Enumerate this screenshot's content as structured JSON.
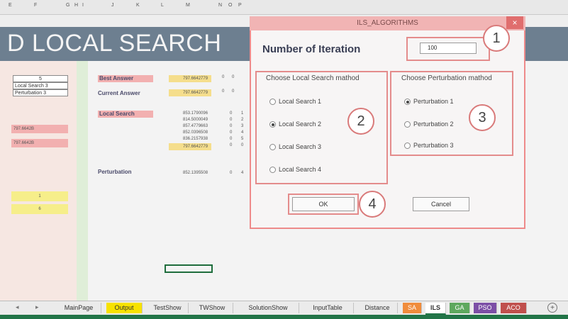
{
  "sheet": {
    "banner_title": "D LOCAL SEARCH",
    "columns": [
      "E",
      "F",
      "G",
      "H",
      "I",
      "J",
      "K",
      "L",
      "M",
      "N",
      "O",
      "P"
    ],
    "left_panel": {
      "cell_top": "5",
      "cell_a": "Local Search 3",
      "cell_b": "Perturbation 3",
      "pink_val_1": "797.6642B",
      "pink_val_2": "797.6642B",
      "yellow_val_1": "1",
      "yellow_val_2": "6"
    },
    "labels": {
      "best_answer": "Best Answer",
      "current_answer": "Current Answer",
      "local_search": "Local Search",
      "perturbation": "Perturbation"
    },
    "values": {
      "best": "797.6642779",
      "current": "797.6642779",
      "ls_rows": [
        "853.1790096",
        "814.5000049",
        "857.4779663",
        "852.0396508",
        "836.2157938",
        "797.6642779"
      ],
      "ls_counts": [
        "1",
        "2",
        "3",
        "4",
        "5",
        "0"
      ],
      "perturb": "852.1395508",
      "perturb_count": "4"
    }
  },
  "tabs": {
    "items": [
      "MainPage",
      "Output",
      "TestShow",
      "TWShow",
      "SolutionShow",
      "InputTable",
      "Distance",
      "SA",
      "ILS",
      "GA",
      "PSO",
      "ACO"
    ]
  },
  "colors": {
    "output_tab": "#f7e200",
    "sa_tab": "#f08c3c",
    "ils_tab": "#ffffff",
    "ga_tab": "#5ea85e",
    "pso_tab": "#7c4fa6",
    "aco_tab": "#c0504d",
    "dialog_border": "#ee8a8a"
  },
  "dialog": {
    "title": "ILS_ALGORITHMS",
    "close_glyph": "×",
    "iteration_label": "Number of Iteration",
    "iteration_value": "100",
    "local_search": {
      "title": "Choose Local Search mathod",
      "options": [
        "Local Search 1",
        "Local Search 2",
        "Local Search 3",
        "Local Search 4"
      ],
      "selected": "Local Search 2"
    },
    "perturbation": {
      "title": "Choose Perturbation mathod",
      "options": [
        "Perturbation 1",
        "Perturbation 2",
        "Perturbation 3"
      ],
      "selected": "Perturbation 1"
    },
    "ok_label": "OK",
    "cancel_label": "Cancel"
  },
  "callouts": [
    "1",
    "2",
    "3",
    "4"
  ]
}
